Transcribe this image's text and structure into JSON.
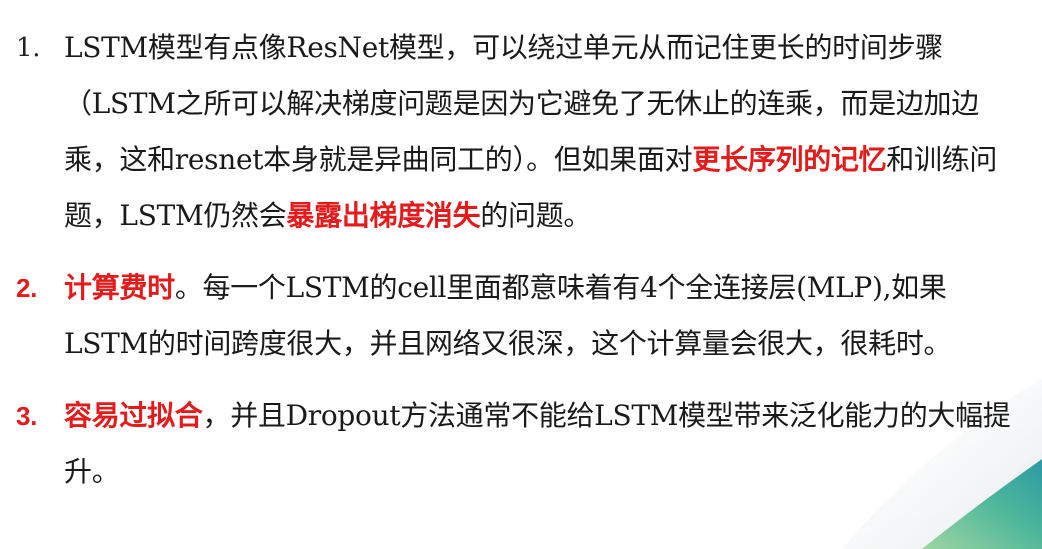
{
  "items": [
    {
      "number": "1.",
      "segments": [
        {
          "text": "LSTM模型有点像ResNet模型，可以绕过单元从而记住更长的时间步骤（LSTM之所可以解决梯度问题是因为它避免了无休止的连乘，而是边加边乘，这和resnet本身就是异曲同工的）。但如果面对",
          "highlight": false
        },
        {
          "text": "更长序列的记忆",
          "highlight": true
        },
        {
          "text": "和训练问题，LSTM仍然会",
          "highlight": false
        },
        {
          "text": "暴露出梯度消失",
          "highlight": true
        },
        {
          "text": "的问题。",
          "highlight": false
        }
      ]
    },
    {
      "number": "2.",
      "segments": [
        {
          "text": "计算费时",
          "highlight": true
        },
        {
          "text": "。每一个LSTM的cell里面都意味着有4个全连接层(MLP),如果LSTM的时间跨度很大，并且网络又很深，这个计算量会很大，很耗时。",
          "highlight": false
        }
      ]
    },
    {
      "number": "3.",
      "segments": [
        {
          "text": "容易过拟合",
          "highlight": true
        },
        {
          "text": "，并且Dropout方法通常不能给LSTM模型带来泛化能力的大幅提升。",
          "highlight": false
        }
      ]
    }
  ],
  "colors": {
    "highlight": "#e31b1b",
    "text": "#1a1a1a",
    "deco_green": "#7cc98f",
    "deco_teal": "#3aa7a3",
    "deco_gray": "#e9ecef"
  }
}
